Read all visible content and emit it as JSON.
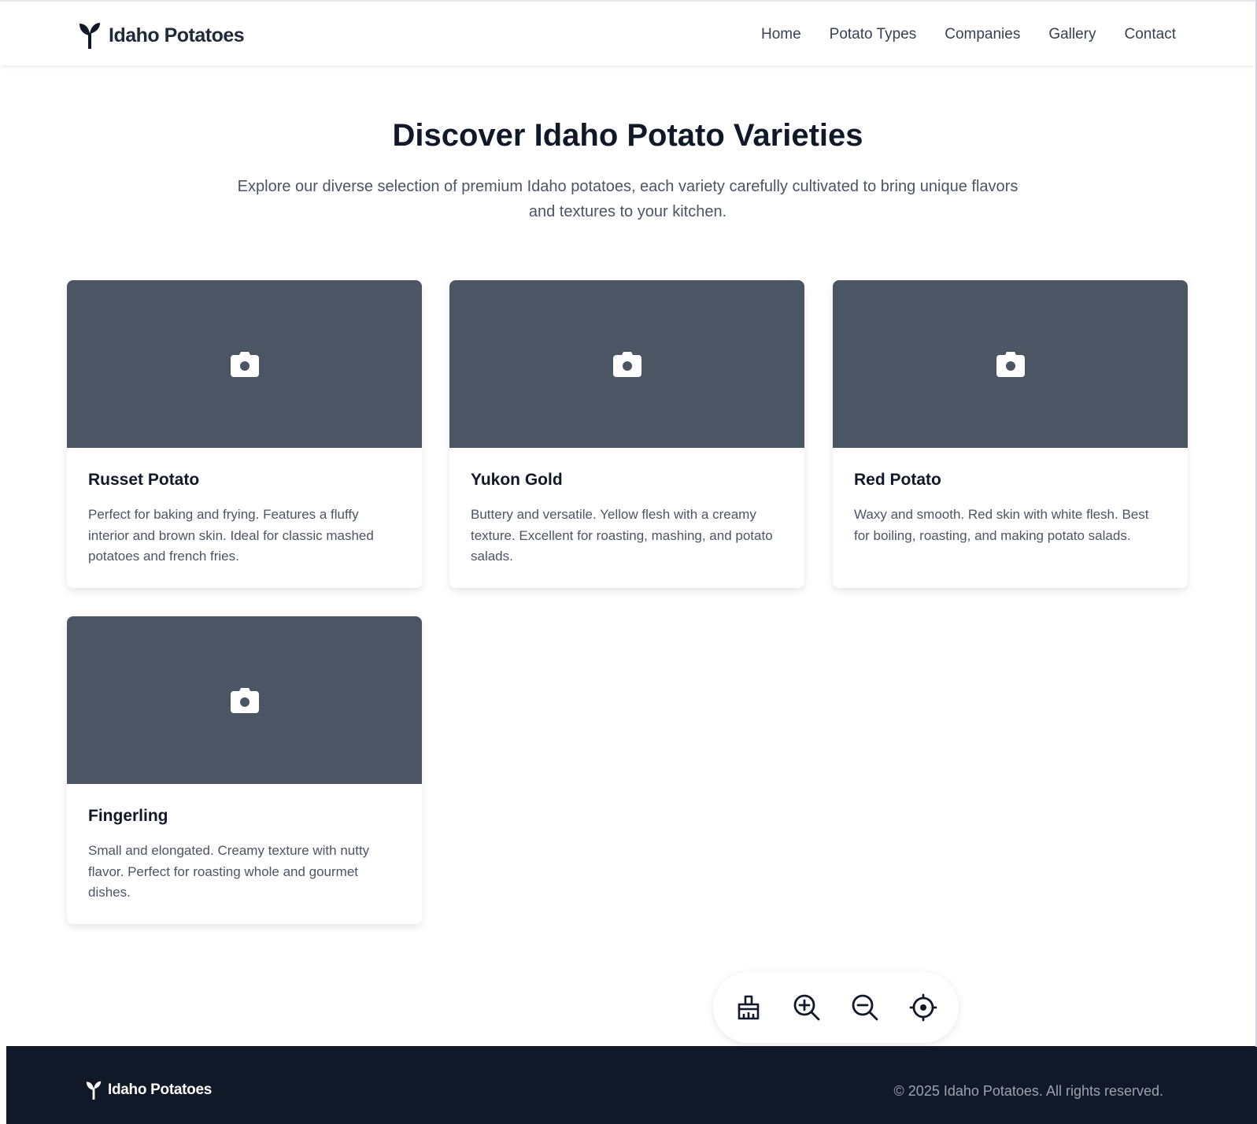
{
  "header": {
    "brand": "Idaho Potatoes",
    "nav": [
      "Home",
      "Potato Types",
      "Companies",
      "Gallery",
      "Contact"
    ]
  },
  "hero": {
    "title": "Discover Idaho Potato Varieties",
    "subtitle": "Explore our diverse selection of premium Idaho potatoes, each variety carefully cultivated to bring unique flavors and textures to your kitchen."
  },
  "cards": [
    {
      "title": "Russet Potato",
      "description": "Perfect for baking and frying. Features a fluffy interior and brown skin. Ideal for classic mashed potatoes and french fries.",
      "icon": "camera-icon"
    },
    {
      "title": "Yukon Gold",
      "description": "Buttery and versatile. Yellow flesh with a creamy texture. Excellent for roasting, mashing, and potato salads.",
      "icon": "camera-icon"
    },
    {
      "title": "Red Potato",
      "description": "Waxy and smooth. Red skin with white flesh. Best for boiling, roasting, and making potato salads.",
      "icon": "camera-icon"
    },
    {
      "title": "Fingerling",
      "description": "Small and elongated. Creamy texture with nutty flavor. Perfect for roasting whole and gourmet dishes.",
      "icon": "camera-icon"
    }
  ],
  "toolbar": {
    "icons": [
      "broom-icon",
      "zoom-in-icon",
      "zoom-out-icon",
      "crosshair-icon"
    ]
  },
  "footer": {
    "brand": "Idaho Potatoes",
    "copyright": "© 2025 Idaho Potatoes. All rights reserved."
  },
  "colors": {
    "card_image_bg": "#4b5563",
    "footer_bg": "#111827",
    "heading": "#111827",
    "body_text": "#4b5563"
  }
}
